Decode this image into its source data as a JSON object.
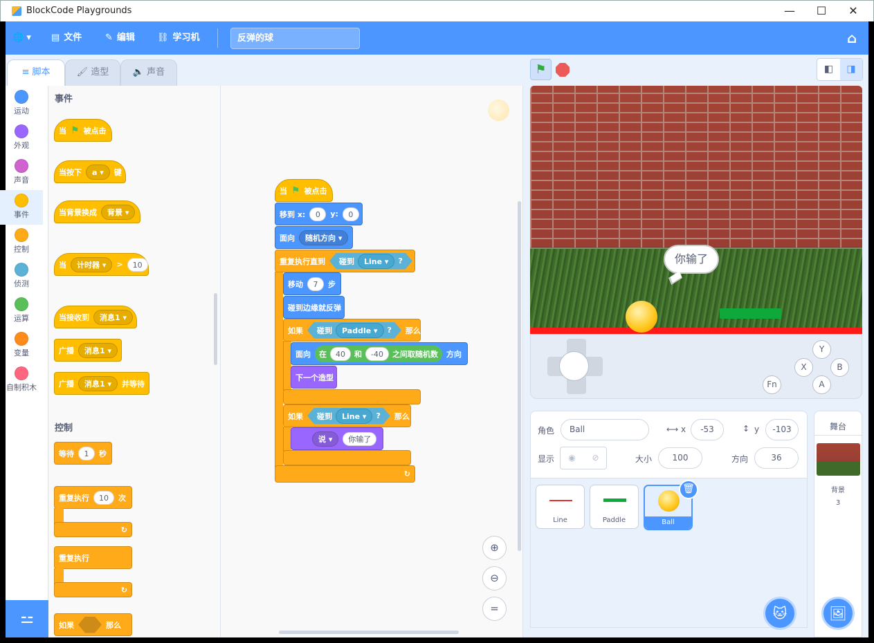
{
  "window": {
    "title": "BlockCode Playgrounds",
    "min": "—",
    "max": "☐",
    "close": "✕"
  },
  "menu": {
    "globe": "🌐 ▾",
    "file": "文件",
    "edit": "编辑",
    "learn": "学习机",
    "project_title": "反弹的球",
    "home": "⌂"
  },
  "tabs": {
    "code": "脚本",
    "costume": "造型",
    "sound": "声音"
  },
  "categories": [
    {
      "label": "运动",
      "color": "#4c97ff"
    },
    {
      "label": "外观",
      "color": "#9966ff"
    },
    {
      "label": "声音",
      "color": "#cf63cf"
    },
    {
      "label": "事件",
      "color": "#ffbf00"
    },
    {
      "label": "控制",
      "color": "#ffab19"
    },
    {
      "label": "侦测",
      "color": "#5cb1d6"
    },
    {
      "label": "运算",
      "color": "#59c059"
    },
    {
      "label": "变量",
      "color": "#ff8c1a"
    },
    {
      "label": "自制积木",
      "color": "#ff6680"
    }
  ],
  "palette": {
    "events_title": "事件",
    "when": "当",
    "clicked": "被点击",
    "key_pressed": "当按下",
    "key": "a ▾",
    "key_suffix": "键",
    "backdrop_switch": "当背景换成",
    "backdrop": "背景 ▾",
    "timer": "计时器 ▾",
    "gt": ">",
    "timer_val": "10",
    "receive": "当接收到",
    "msg1": "消息1 ▾",
    "broadcast": "广播",
    "broadcast_wait": "并等待",
    "control_title": "控制",
    "wait": "等待",
    "wait_val": "1",
    "seconds": "秒",
    "repeat": "重复执行",
    "repeat_val": "10",
    "times": "次",
    "forever": "重复执行",
    "if": "如果",
    "then": "那么"
  },
  "script": {
    "hat_when": "当",
    "hat_clicked": "被点击",
    "goto": "移到 x:",
    "x_val": "0",
    "y_label": "y:",
    "y_val": "0",
    "point": "面向",
    "random_dir": "随机方向 ▾",
    "repeat_until": "重复执行直到",
    "touching": "碰到",
    "line": "Line ▾",
    "q": "?",
    "move": "移动",
    "steps_val": "7",
    "steps": "步",
    "bounce": "碰到边缘就反弹",
    "if": "如果",
    "paddle": "Paddle ▾",
    "then": "那么",
    "point2": "面向",
    "in": "在",
    "r1": "40",
    "and": "和",
    "r2": "-40",
    "random_between": "之间取随机数",
    "direction": "方向",
    "next_costume": "下一个造型",
    "if2": "如果",
    "touching2": "碰到",
    "line2": "Line ▾",
    "q2": "?",
    "then2": "那么",
    "say": "说 ▾",
    "say_text": "你输了",
    "loop_arrow": "↻"
  },
  "zoom": {
    "in": "⊕",
    "out": "⊖",
    "reset": "="
  },
  "stage": {
    "bubble": "你输了"
  },
  "gamepad": {
    "y": "Y",
    "x": "X",
    "b": "B",
    "a": "A",
    "fn": "Fn"
  },
  "sprite": {
    "label": "角色",
    "name": "Ball",
    "x_label": "x",
    "x": "-53",
    "y_label": "y",
    "y": "-103",
    "show_label": "显示",
    "size_label": "大小",
    "size": "100",
    "dir_label": "方向",
    "dir": "36"
  },
  "sprites": [
    {
      "name": "Line"
    },
    {
      "name": "Paddle"
    },
    {
      "name": "Ball"
    }
  ],
  "stagepanel": {
    "title": "舞台",
    "backdrop_label": "背景",
    "backdrop_count": "3"
  }
}
